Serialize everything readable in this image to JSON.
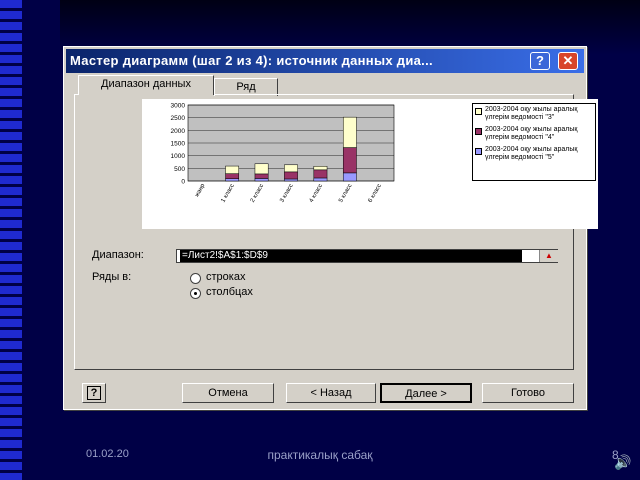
{
  "dialog": {
    "title": "Мастер диаграмм (шаг 2 из 4): источник данных диа...",
    "help_glyph": "?",
    "close_glyph": "✕"
  },
  "tabs": [
    {
      "label": "Диапазон данных",
      "active": true
    },
    {
      "label": "Ряд",
      "active": false
    }
  ],
  "form": {
    "range_label": "Диапазон:",
    "range_value": "=Лист2!$A$1:$D$9",
    "series_in_label": "Ряды в:",
    "rows_option": "строках",
    "columns_option": "столбцах",
    "selected": "columns"
  },
  "buttons": {
    "help": "?",
    "cancel": "Отмена",
    "back": "< Назад",
    "next": "Далее >",
    "finish": "Готово"
  },
  "chart_data": {
    "type": "bar",
    "stacked": true,
    "categories": [
      "жанр",
      "1 класс",
      "2 класс",
      "3 класс",
      "4 класс",
      "5 класс",
      "6 класс"
    ],
    "series": [
      {
        "name": "2003-2004 оқу жылы аралық үлгерім ведомості \"3\"",
        "color": "#ffffcc",
        "values": [
          0,
          300,
          400,
          280,
          140,
          1200,
          0
        ]
      },
      {
        "name": "2003-2004 оқу жылы аралық үлгерім ведомості \"4\"",
        "color": "#993366",
        "values": [
          0,
          200,
          180,
          280,
          320,
          1000,
          0
        ]
      },
      {
        "name": "2003-2004 оқу жылы аралық үлгерім ведомості \"5\"",
        "color": "#9999ff",
        "values": [
          0,
          90,
          100,
          80,
          120,
          320,
          0
        ]
      }
    ],
    "ylim": [
      0,
      3000
    ],
    "yticks": [
      0,
      500,
      1000,
      1500,
      2000,
      2500,
      3000
    ],
    "grid": true,
    "legend_position": "right"
  },
  "footer": {
    "date": "01.02.20",
    "title": "практикалық сабақ",
    "page": "8"
  }
}
